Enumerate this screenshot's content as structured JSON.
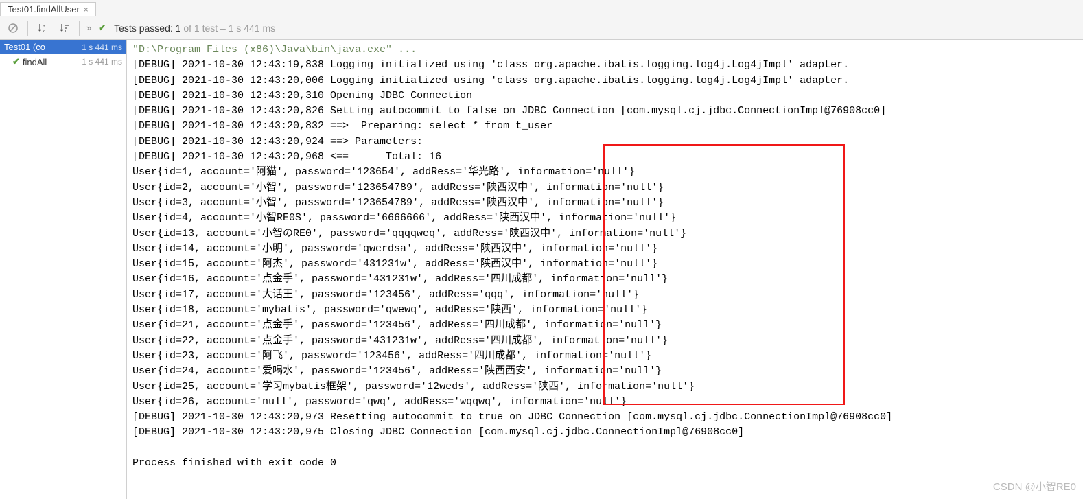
{
  "tab": {
    "title": "Test01.findAllUser"
  },
  "toolbar": {
    "status_prefix": "Tests passed:",
    "status_count": "1",
    "status_of": "of 1 test",
    "status_time": "– 1 s 441 ms"
  },
  "tree": {
    "root": {
      "label": "Test01 (co",
      "time": "1 s 441 ms"
    },
    "child": {
      "label": "findAll",
      "time": "1 s 441 ms"
    }
  },
  "console": {
    "cmd": "\"D:\\Program Files (x86)\\Java\\bin\\java.exe\" ...",
    "lines": [
      "[DEBUG] 2021-10-30 12:43:19,838 Logging initialized using 'class org.apache.ibatis.logging.log4j.Log4jImpl' adapter.",
      "[DEBUG] 2021-10-30 12:43:20,006 Logging initialized using 'class org.apache.ibatis.logging.log4j.Log4jImpl' adapter.",
      "[DEBUG] 2021-10-30 12:43:20,310 Opening JDBC Connection",
      "[DEBUG] 2021-10-30 12:43:20,826 Setting autocommit to false on JDBC Connection [com.mysql.cj.jdbc.ConnectionImpl@76908cc0]",
      "[DEBUG] 2021-10-30 12:43:20,832 ==>  Preparing: select * from t_user",
      "[DEBUG] 2021-10-30 12:43:20,924 ==> Parameters:",
      "[DEBUG] 2021-10-30 12:43:20,968 <==      Total: 16",
      "User{id=1, account='阿猫', password='123654', addRess='华光路', information='null'}",
      "User{id=2, account='小智', password='123654789', addRess='陕西汉中', information='null'}",
      "User{id=3, account='小智', password='123654789', addRess='陕西汉中', information='null'}",
      "User{id=4, account='小智RE0S', password='6666666', addRess='陕西汉中', information='null'}",
      "User{id=13, account='小智のRE0', password='qqqqweq', addRess='陕西汉中', information='null'}",
      "User{id=14, account='小明', password='qwerdsa', addRess='陕西汉中', information='null'}",
      "User{id=15, account='阿杰', password='431231w', addRess='陕西汉中', information='null'}",
      "User{id=16, account='点金手', password='431231w', addRess='四川成都', information='null'}",
      "User{id=17, account='大话王', password='123456', addRess='qqq', information='null'}",
      "User{id=18, account='mybatis', password='qwewq', addRess='陕西', information='null'}",
      "User{id=21, account='点金手', password='123456', addRess='四川成都', information='null'}",
      "User{id=22, account='点金手', password='431231w', addRess='四川成都', information='null'}",
      "User{id=23, account='阿飞', password='123456', addRess='四川成都', information='null'}",
      "User{id=24, account='爱喝水', password='123456', addRess='陕西西安', information='null'}",
      "User{id=25, account='学习mybatis框架', password='12weds', addRess='陕西', information='null'}",
      "User{id=26, account='null', password='qwq', addRess='wqqwq', information='null'}",
      "[DEBUG] 2021-10-30 12:43:20,973 Resetting autocommit to true on JDBC Connection [com.mysql.cj.jdbc.ConnectionImpl@76908cc0]",
      "[DEBUG] 2021-10-30 12:43:20,975 Closing JDBC Connection [com.mysql.cj.jdbc.ConnectionImpl@76908cc0]",
      "",
      "Process finished with exit code 0"
    ]
  },
  "watermark": "CSDN @小智RE0"
}
